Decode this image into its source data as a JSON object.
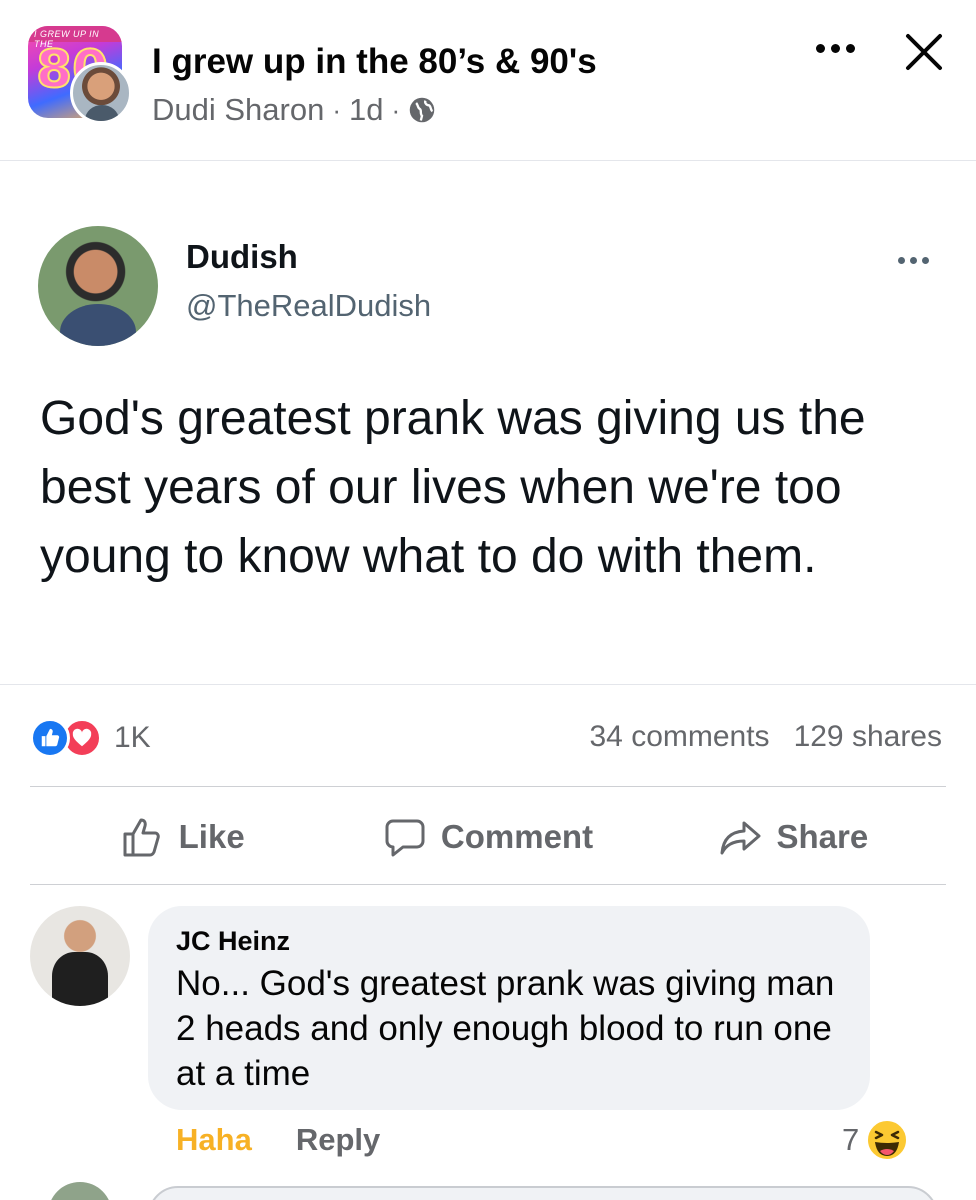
{
  "header": {
    "group_avatar_text": "I GREW UP IN THE",
    "group_avatar_number": "80",
    "group_name": "I grew up in the 80’s & 90's",
    "author": "Dudi Sharon",
    "separator": "·",
    "time": "1d",
    "icons": {
      "privacy": "globe-icon",
      "menu": "more-icon",
      "close": "close-icon"
    }
  },
  "tweet": {
    "display_name": "Dudish",
    "handle": "@TheRealDudish",
    "text": "God's greatest prank was giving us the best years of our lives when we're too young to know what to do with them."
  },
  "reactions": {
    "types": [
      "like",
      "love"
    ],
    "count": "1K",
    "comments": "34 comments",
    "shares": "129 shares",
    "colors": {
      "like": "#1877f2",
      "love": "#f33e58"
    }
  },
  "actions": {
    "like": "Like",
    "comment": "Comment",
    "share": "Share"
  },
  "comment": {
    "author": "JC Heinz",
    "text": "No... God's greatest prank was giving man 2 heads and only enough blood to run one at a time",
    "reaction_label": "Haha",
    "reply_label": "Reply",
    "reaction_count": "7",
    "reaction_icon": "haha-emoji-icon",
    "haha_color": "#f7b125"
  }
}
